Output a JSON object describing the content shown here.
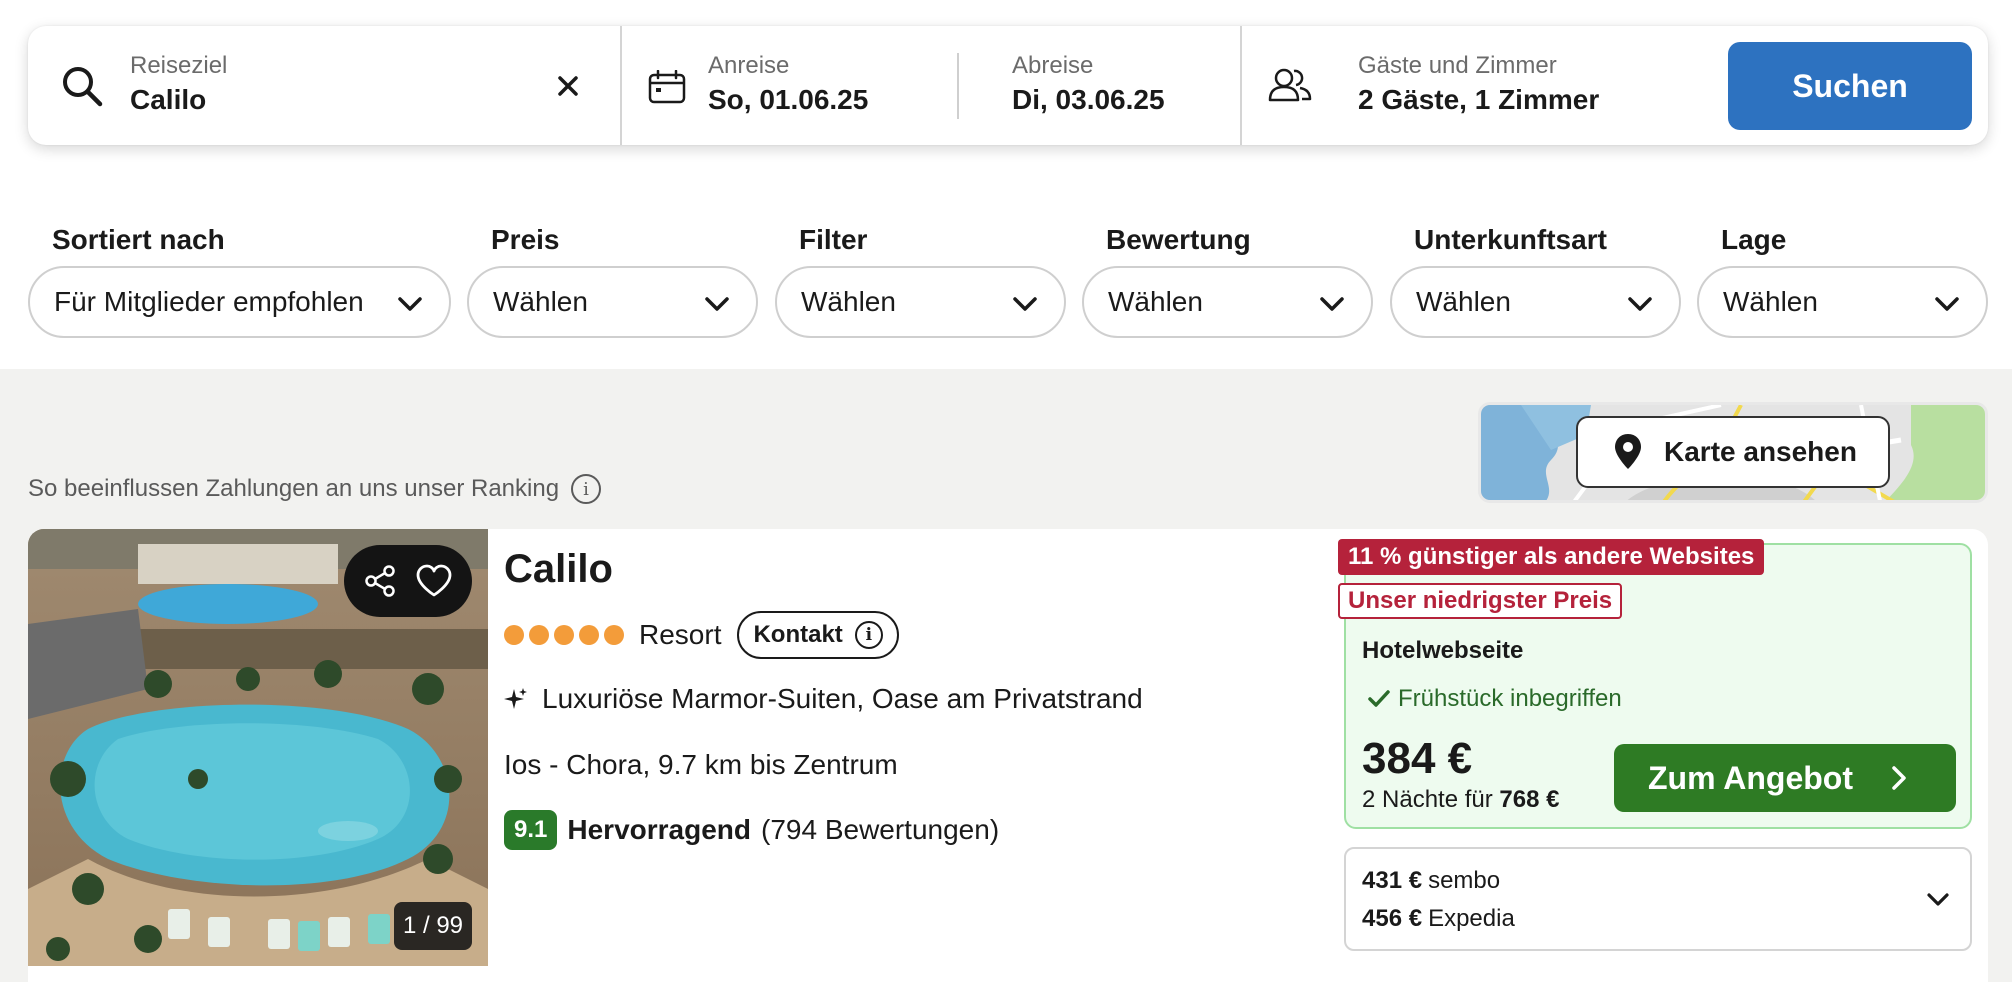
{
  "search": {
    "destination_label": "Reiseziel",
    "destination_value": "Calilo",
    "checkin_label": "Anreise",
    "checkin_value": "So, 01.06.25",
    "checkout_label": "Abreise",
    "checkout_value": "Di, 03.06.25",
    "guests_label": "Gäste und Zimmer",
    "guests_value": "2 Gäste, 1 Zimmer",
    "search_button": "Suchen"
  },
  "filters": [
    {
      "label": "Sortiert nach",
      "value": "Für Mitglieder empfohlen"
    },
    {
      "label": "Preis",
      "value": "Wählen"
    },
    {
      "label": "Filter",
      "value": "Wählen"
    },
    {
      "label": "Bewertung",
      "value": "Wählen"
    },
    {
      "label": "Unterkunftsart",
      "value": "Wählen"
    },
    {
      "label": "Lage",
      "value": "Wählen"
    }
  ],
  "ranking_note": "So beeinflussen Zahlungen an uns unser Ranking",
  "map_button": "Karte ansehen",
  "hotel": {
    "name": "Calilo",
    "stars": 5,
    "type": "Resort",
    "contact_label": "Kontakt",
    "highlight": "Luxuriöse Marmor-Suiten, Oase am Privatstrand",
    "location": "Ios - Chora, 9.7 km bis Zentrum",
    "score": "9.1",
    "rating_word": "Hervorragend",
    "reviews": "(794 Bewertungen)",
    "photo_counter": "1 / 99"
  },
  "deal": {
    "badge_cheaper": "11 % günstiger als andere Websites",
    "badge_lowest": "Unser niedrigster Preis",
    "provider": "Hotelwebseite",
    "breakfast": "Frühstück inbegriffen",
    "price": "384 €",
    "total_prefix": "2 Nächte für",
    "total_value": "768 €",
    "offer_button": "Zum Angebot"
  },
  "other_offers": [
    {
      "price": "431 €",
      "provider": "sembo"
    },
    {
      "price": "456 €",
      "provider": "Expedia"
    }
  ],
  "colors": {
    "search_button": "#2d72c0",
    "offer_button": "#2e7b24",
    "badge_red": "#b5223b",
    "score_green": "#2a7a2a",
    "stars_orange": "#f39c3a"
  }
}
